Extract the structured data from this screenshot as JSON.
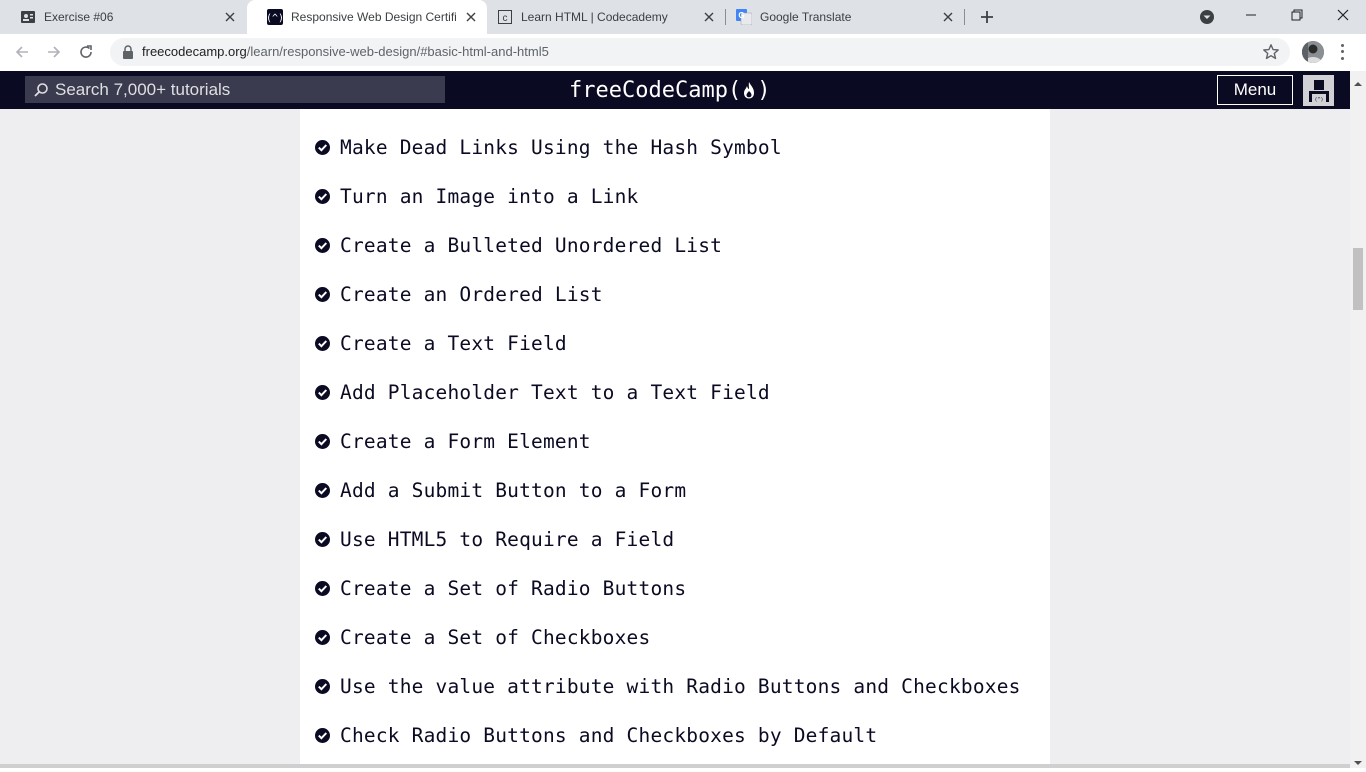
{
  "browser": {
    "tabs": [
      {
        "title": "Exercise #06",
        "active": false,
        "icon": "contact-card-icon"
      },
      {
        "title": "Responsive Web Design Certificat",
        "active": true,
        "icon": "freecodecamp-icon"
      },
      {
        "title": "Learn HTML | Codecademy",
        "active": false,
        "icon": "codecademy-icon"
      },
      {
        "title": "Google Translate",
        "active": false,
        "icon": "google-translate-icon"
      }
    ],
    "address": {
      "domain": "freecodecamp.org",
      "path": "/learn/responsive-web-design/#basic-html-and-html5"
    }
  },
  "fcc_nav": {
    "search_placeholder": "Search 7,000+ tutorials",
    "logo_left": "freeCodeCamp(",
    "logo_right": ")",
    "menu_label": "Menu"
  },
  "lessons": [
    {
      "title": "Make Dead Links Using the Hash Symbol",
      "completed": true
    },
    {
      "title": "Turn an Image into a Link",
      "completed": true
    },
    {
      "title": "Create a Bulleted Unordered List",
      "completed": true
    },
    {
      "title": "Create an Ordered List",
      "completed": true
    },
    {
      "title": "Create a Text Field",
      "completed": true
    },
    {
      "title": "Add Placeholder Text to a Text Field",
      "completed": true
    },
    {
      "title": "Create a Form Element",
      "completed": true
    },
    {
      "title": "Add a Submit Button to a Form",
      "completed": true
    },
    {
      "title": "Use HTML5 to Require a Field",
      "completed": true
    },
    {
      "title": "Create a Set of Radio Buttons",
      "completed": true
    },
    {
      "title": "Create a Set of Checkboxes",
      "completed": true
    },
    {
      "title": "Use the value attribute with Radio Buttons and Checkboxes",
      "completed": true
    },
    {
      "title": "Check Radio Buttons and Checkboxes by Default",
      "completed": true
    }
  ],
  "colors": {
    "nav_bg": "#0a0a23",
    "text": "#0a0a23",
    "page_bg": "#eeeef0"
  }
}
